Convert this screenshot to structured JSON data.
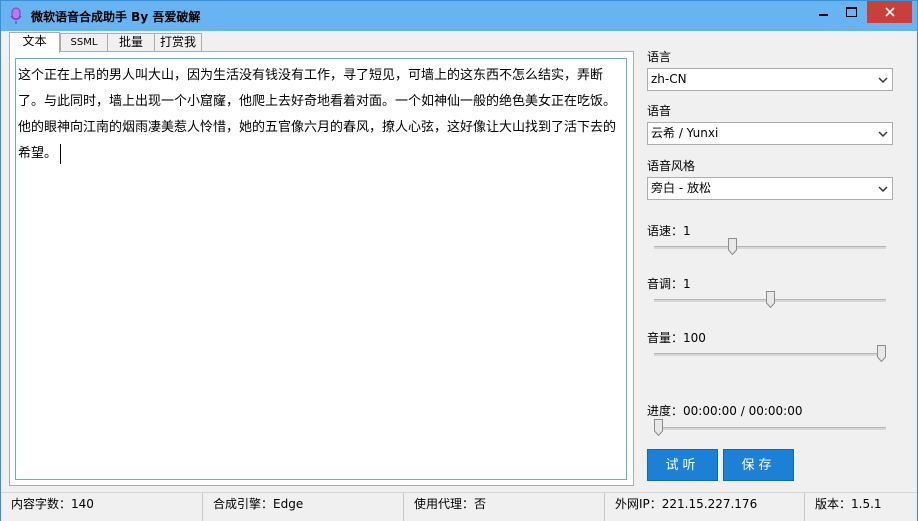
{
  "window": {
    "title": "微软语音合成助手 By 吾爱破解"
  },
  "tabs": [
    {
      "label": "文本",
      "active": true
    },
    {
      "label": "SSML",
      "active": false
    },
    {
      "label": "批量",
      "active": false
    },
    {
      "label": "打赏我",
      "active": false
    }
  ],
  "editor": {
    "text": "这个正在上吊的男人叫大山，因为生活没有钱没有工作，寻了短见，可墙上的这东西不怎么结实，弄断了。与此同时，墙上出现一个小窟窿，他爬上去好奇地看着对面。一个如神仙一般的绝色美女正在吃饭。他的眼神向江南的烟雨凄美惹人怜惜，她的五官像六月的春风，撩人心弦，这好像让大山找到了活下去的希望。"
  },
  "settings": {
    "language_label": "语言",
    "language_value": "zh-CN",
    "voice_label": "语音",
    "voice_value": "云希 / Yunxi",
    "style_label": "语音风格",
    "style_value": "旁白 - 放松",
    "rate_label": "语速：1",
    "rate_level": 0.33,
    "pitch_label": "音调：1",
    "pitch_level": 0.5,
    "volume_label": "音量：100",
    "volume_level": 1.0,
    "progress_label": "进度：00:00:00 / 00:00:00",
    "progress_level": 0.0,
    "listen_button": "试听",
    "save_button": "保存"
  },
  "statusbar": {
    "char_count": "内容字数：140",
    "engine": "合成引擎：Edge",
    "proxy": "使用代理：否",
    "public_ip": "外网IP：221.15.227.176",
    "version": "版本：1.5.1"
  },
  "colors": {
    "titlebar": "#68b4f2",
    "close_button": "#c7403a",
    "accent_button": "#1d80d5",
    "editor_border": "#6aa9dd"
  },
  "icons": {
    "app": "microphone-icon",
    "minimize": "minimize-icon",
    "maximize": "maximize-icon",
    "close": "close-icon",
    "dropdown": "chevron-down-icon"
  }
}
